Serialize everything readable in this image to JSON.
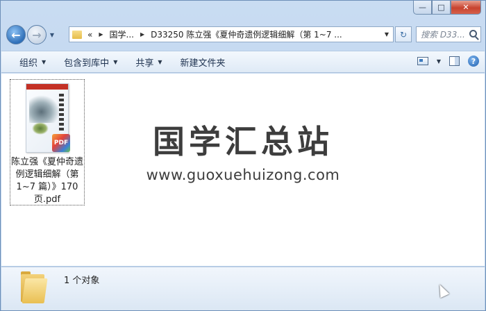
{
  "window": {
    "minimize_glyph": "—",
    "maximize_glyph": "□",
    "close_glyph": "✕"
  },
  "nav": {
    "back_glyph": "←",
    "forward_glyph": "→",
    "recent_glyph": "▼",
    "breadcrumb": [
      "«",
      "国学...",
      "D33250 陈立强《夏仲奇遗例逻辑细解（第 1~7 ..."
    ],
    "refresh_glyph": "↻",
    "search_placeholder": "搜索 D33..."
  },
  "toolbar": {
    "organize": "组织",
    "include_library": "包含到库中",
    "share": "共享",
    "new_folder": "新建文件夹"
  },
  "file": {
    "name": "陈立强《夏仲奇遗例逻辑细解（第1~7 篇）》170页.pdf",
    "badge": "PDF"
  },
  "watermark": {
    "title": "国学汇总站",
    "url": "www.guoxuehuizong.com"
  },
  "details": {
    "count_text": "1 个对象"
  }
}
